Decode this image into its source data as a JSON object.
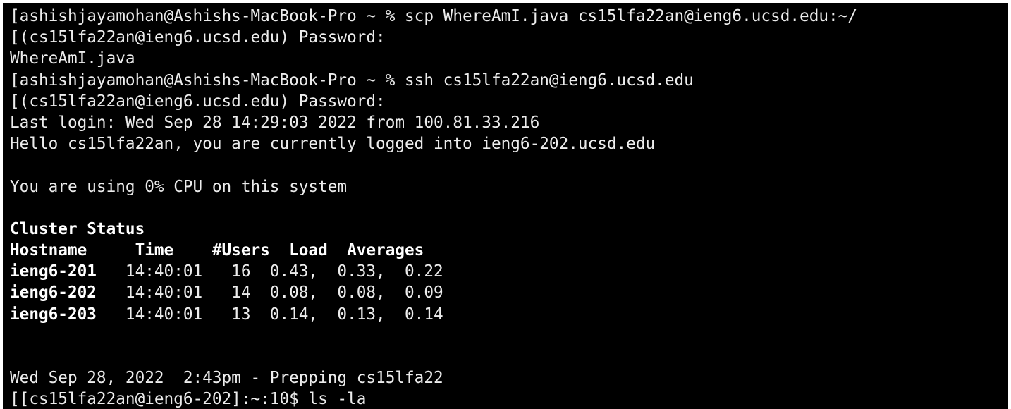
{
  "terminal": {
    "lines": [
      {
        "text": "[ashishjayamohan@Ashishs-MacBook-Pro ~ % scp WhereAmI.java cs15lfa22an@ieng6.ucsd.edu:~/"
      },
      {
        "text": "[(cs15lfa22an@ieng6.ucsd.edu) Password:"
      },
      {
        "text": "WhereAmI.java"
      },
      {
        "text": "[ashishjayamohan@Ashishs-MacBook-Pro ~ % ssh cs15lfa22an@ieng6.ucsd.edu"
      },
      {
        "text": "[(cs15lfa22an@ieng6.ucsd.edu) Password:"
      },
      {
        "text": "Last login: Wed Sep 28 14:29:03 2022 from 100.81.33.216"
      },
      {
        "text": "Hello cs15lfa22an, you are currently logged into ieng6-202.ucsd.edu"
      },
      {
        "text": ""
      },
      {
        "text": "You are using 0% CPU on this system"
      },
      {
        "text": ""
      },
      {
        "text": "Cluster Status"
      },
      {
        "text": "Hostname     Time    #Users  Load  Averages"
      },
      {
        "host": "ieng6-201",
        "rest": "   14:40:01   16  0.43,  0.33,  0.22"
      },
      {
        "host": "ieng6-202",
        "rest": "   14:40:01   14  0.08,  0.08,  0.09"
      },
      {
        "host": "ieng6-203",
        "rest": "   14:40:01   13  0.14,  0.13,  0.14"
      },
      {
        "text": ""
      },
      {
        "text": ""
      },
      {
        "text": "Wed Sep 28, 2022  2:43pm - Prepping cs15lfa22"
      },
      {
        "text": "[[cs15lfa22an@ieng6-202]:~:10$ ls -la"
      }
    ]
  }
}
